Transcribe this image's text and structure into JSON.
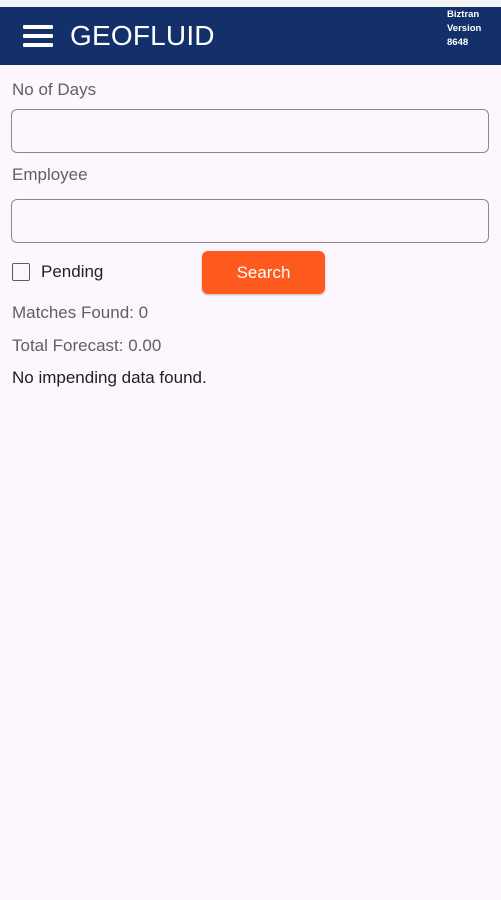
{
  "app": {
    "title": "GEOFLUID",
    "version_lines": [
      "Biztran",
      "Version",
      "8648"
    ]
  },
  "form": {
    "days_label": "No of Days",
    "days_value": "",
    "employee_label": "Employee",
    "employee_value": "",
    "pending_label": "Pending",
    "pending_checked": false,
    "search_label": "Search"
  },
  "results": {
    "matches_text": "Matches Found: 0",
    "forecast_text": "Total Forecast: 0.00",
    "empty_message": "No impending data found."
  },
  "colors": {
    "appbar": "#14306a",
    "accent": "#fe5a1d",
    "background": "#fdf7fd"
  },
  "icons": {
    "menu": "hamburger-menu-icon"
  }
}
